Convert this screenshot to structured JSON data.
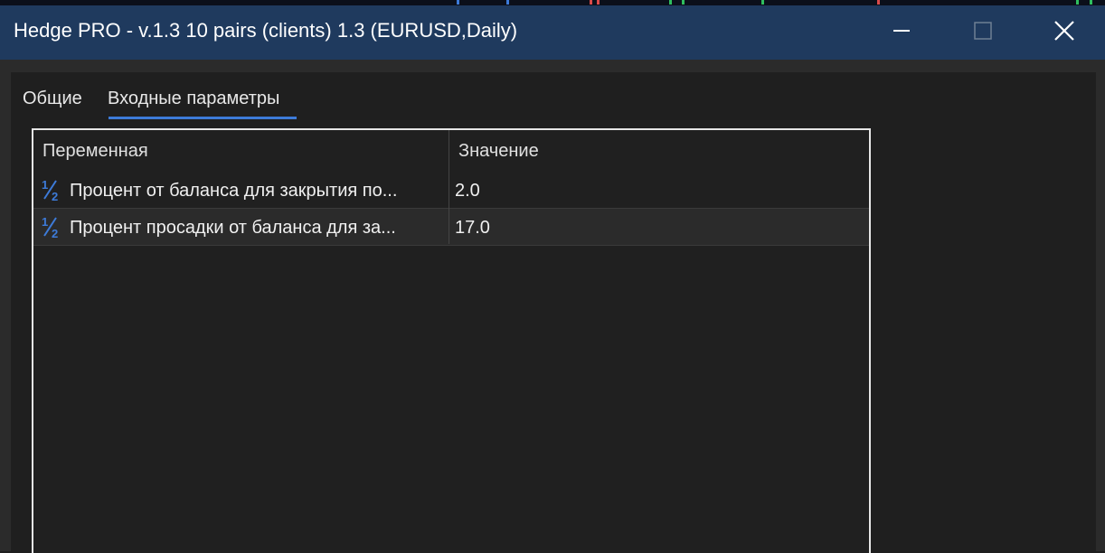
{
  "window": {
    "title": "Hedge PRO - v.1.3 10 pairs (clients) 1.3 (EURUSD,Daily)",
    "controls": [
      "minimize-icon",
      "maximize-icon",
      "close-icon"
    ]
  },
  "tabs": [
    {
      "label": "Общие",
      "active": false
    },
    {
      "label": "Входные параметры",
      "active": true
    }
  ],
  "table": {
    "columns": [
      "Переменная",
      "Значение"
    ],
    "rows": [
      {
        "icon": "half-fraction-icon",
        "variable": "Процент от баланса для закрытия по...",
        "value": "2.0"
      },
      {
        "icon": "half-fraction-icon",
        "variable": "Процент просадки от баланса для за...",
        "value": "17.0"
      }
    ]
  },
  "colors": {
    "titlebar": "#1f3a5e",
    "accent": "#3d7bd9",
    "background": "#1f1f1f"
  }
}
